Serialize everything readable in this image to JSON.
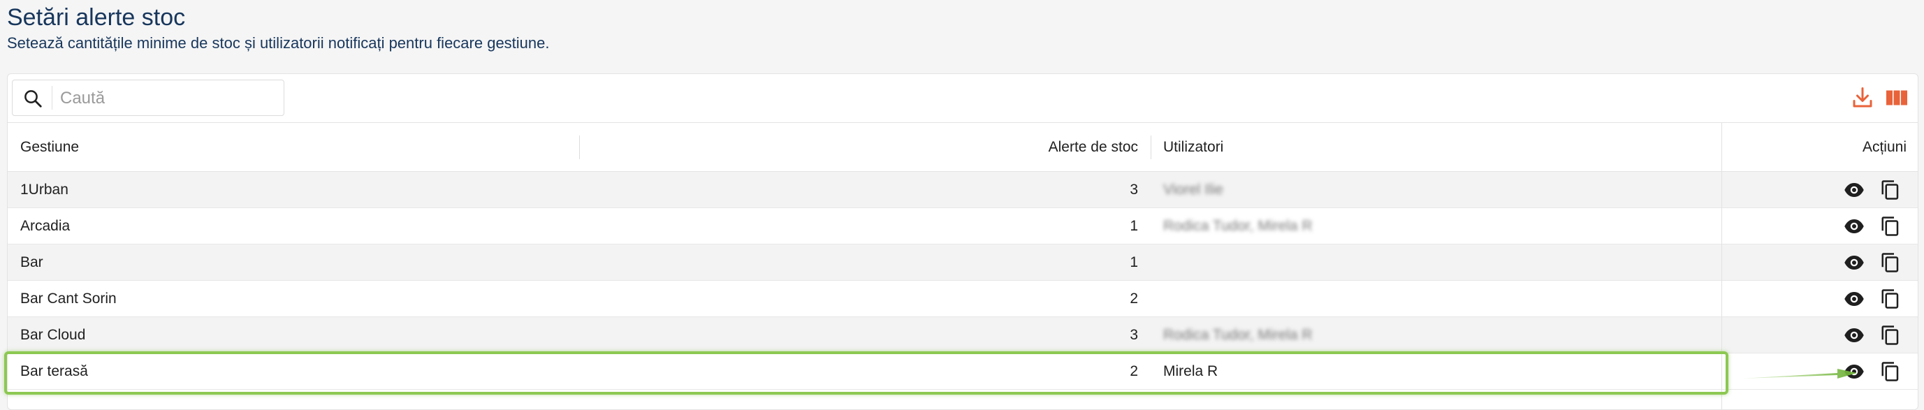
{
  "page": {
    "title": "Setări alerte stoc",
    "subtitle": "Setează cantitățile minime de stoc și utilizatorii notificați pentru fiecare gestiune."
  },
  "toolbar": {
    "search_placeholder": "Caută",
    "search_value": "",
    "download_icon": "download-icon",
    "columns_icon": "columns-icon",
    "accent_color": "#e8633a"
  },
  "table": {
    "columns": {
      "gestiune": "Gestiune",
      "alerte": "Alerte de stoc",
      "utilizatori": "Utilizatori",
      "actiuni": "Acțiuni"
    },
    "rows": [
      {
        "gestiune": "1Urban",
        "alerte": "3",
        "utilizatori": "Viorel Ilie",
        "blurred": true
      },
      {
        "gestiune": "Arcadia",
        "alerte": "1",
        "utilizatori": "Rodica Tudor, Mirela R",
        "blurred": true
      },
      {
        "gestiune": "Bar",
        "alerte": "1",
        "utilizatori": "",
        "blurred": true
      },
      {
        "gestiune": "Bar Cant Sorin",
        "alerte": "2",
        "utilizatori": "",
        "blurred": true
      },
      {
        "gestiune": "Bar Cloud",
        "alerte": "3",
        "utilizatori": "Rodica Tudor, Mirela R",
        "blurred": true
      },
      {
        "gestiune": "Bar terasă",
        "alerte": "2",
        "utilizatori": "Mirela R",
        "blurred": false
      }
    ],
    "row_actions": [
      "eye-icon",
      "copy-icon"
    ]
  },
  "annotation": {
    "highlight_color": "#8cc852",
    "highlighted_row": "Bar terasă"
  }
}
